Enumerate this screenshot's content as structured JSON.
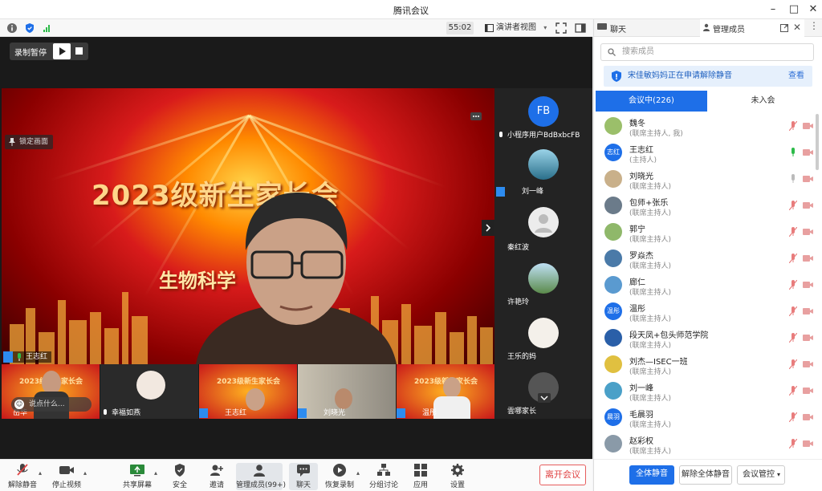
{
  "window": {
    "title": "腾讯会议"
  },
  "toolbar": {
    "timer": "55:02",
    "view_label": "演讲者视图"
  },
  "recording": {
    "label": "录制暂停"
  },
  "main_video": {
    "lock_label": "锁定画面",
    "banner_title": "2023级新生家长会",
    "banner_sub": "生物科学",
    "speaker_name": "王志红"
  },
  "side_participants": [
    {
      "name": "小程序用户BdBxbcFB",
      "avatar_text": "FB"
    },
    {
      "name": "刘一峰",
      "avatar_text": ""
    },
    {
      "name": "秦红波",
      "avatar_text": ""
    },
    {
      "name": "许艳玲",
      "avatar_text": ""
    },
    {
      "name": "王乐的妈",
      "avatar_text": ""
    },
    {
      "name": "雲哪家长",
      "avatar_text": ""
    }
  ],
  "thumbnails": [
    {
      "name": "岳华",
      "banner": "2023级新生家长会"
    },
    {
      "name": "幸福如燕",
      "banner": ""
    },
    {
      "name": "王志红",
      "banner": "2023级新生家长会"
    },
    {
      "name": "刘晓光",
      "banner": ""
    },
    {
      "name": "温彤",
      "banner": "2023级新生家长会"
    }
  ],
  "caption_prompt": "说点什么...",
  "bottom_bar": {
    "unmute": "解除静音",
    "stop_video": "停止视频",
    "share": "共享屏幕",
    "security": "安全",
    "invite": "邀请",
    "manage": "管理成员(99+)",
    "chat": "聊天",
    "resume_record": "恢复录制",
    "breakout": "分组讨论",
    "apps": "应用",
    "settings": "设置",
    "leave": "离开会议"
  },
  "panel": {
    "tab_chat": "聊天",
    "tab_members": "管理成员",
    "search_placeholder": "搜索成员",
    "notice_text": "宋佳敏妈妈正在申请解除静音",
    "notice_view": "查看",
    "tab_in_meeting": "会议中(226)",
    "tab_not_joined": "未入会",
    "members": [
      {
        "name": "魏冬",
        "role": "(联席主持人, 我)",
        "avatar_text": "",
        "color": "#9bbf6a",
        "mic": "muted"
      },
      {
        "name": "王志红",
        "role": "(主持人)",
        "avatar_text": "志红",
        "color": "#1e6fe8",
        "mic": "on"
      },
      {
        "name": "刘晓光",
        "role": "(联席主持人)",
        "avatar_text": "",
        "color": "#c9b08a",
        "mic": "idle"
      },
      {
        "name": "包师+张乐",
        "role": "(联席主持人)",
        "avatar_text": "",
        "color": "#6b7b8a",
        "mic": "muted"
      },
      {
        "name": "郭宁",
        "role": "(联席主持人)",
        "avatar_text": "",
        "color": "#8fb86a",
        "mic": "muted"
      },
      {
        "name": "罗焱杰",
        "role": "(联席主持人)",
        "avatar_text": "",
        "color": "#4a7aa8",
        "mic": "muted"
      },
      {
        "name": "廊仁",
        "role": "(联席主持人)",
        "avatar_text": "",
        "color": "#5a9ad0",
        "mic": "muted"
      },
      {
        "name": "温彤",
        "role": "(联席主持人)",
        "avatar_text": "温彤",
        "color": "#1e6fe8",
        "mic": "muted"
      },
      {
        "name": "段天凤+包头师范学院",
        "role": "(联席主持人)",
        "avatar_text": "",
        "color": "#2a5fa8",
        "mic": "muted"
      },
      {
        "name": "刘杰—ISEC一班",
        "role": "(联席主持人)",
        "avatar_text": "",
        "color": "#e0c040",
        "mic": "muted"
      },
      {
        "name": "刘一峰",
        "role": "(联席主持人)",
        "avatar_text": "",
        "color": "#4aa0c8",
        "mic": "muted"
      },
      {
        "name": "毛晨羽",
        "role": "(联席主持人)",
        "avatar_text": "晨羽",
        "color": "#1e6fe8",
        "mic": "muted"
      },
      {
        "name": "赵彩权",
        "role": "(联席主持人)",
        "avatar_text": "",
        "color": "#8a9aa8",
        "mic": "muted"
      }
    ],
    "footer": {
      "mute_all": "全体静音",
      "unmute_all": "解除全体静音",
      "control": "会议管控"
    }
  },
  "colors": {
    "accent": "#1e6fe8",
    "danger": "#e04444",
    "unmuted_mic": "#2dbb4a"
  }
}
